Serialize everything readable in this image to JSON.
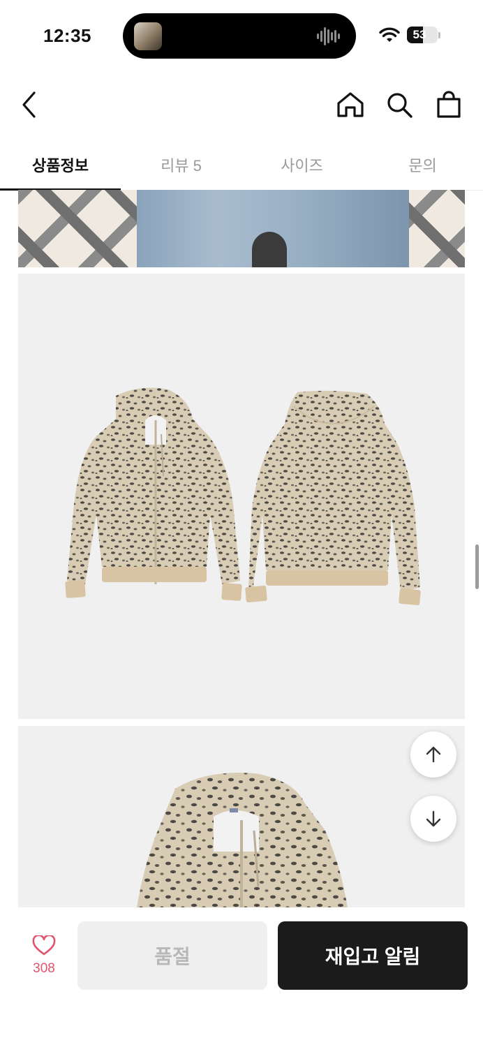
{
  "status_bar": {
    "time": "12:35",
    "battery": "53",
    "battery_level_percent": 53
  },
  "nav": {
    "back_icon": "chevron-left-icon",
    "home_icon": "home-icon",
    "search_icon": "search-icon",
    "cart_icon": "shopping-bag-icon"
  },
  "tabs": [
    {
      "label": "상품정보",
      "active": true
    },
    {
      "label": "리뷰 5",
      "active": false
    },
    {
      "label": "사이즈",
      "active": false
    },
    {
      "label": "문의",
      "active": false
    }
  ],
  "floating": {
    "up_icon": "arrow-up-icon",
    "down_icon": "arrow-down-icon"
  },
  "bottom": {
    "like_icon": "heart-icon",
    "like_count": "308",
    "soldout_label": "품절",
    "restock_label": "재입고 알림"
  },
  "colors": {
    "accent_heart": "#e0556b",
    "primary_button": "#1b1b1b",
    "disabled_button": "#efefef",
    "leopard_base": "#d9ccb4",
    "leopard_spot": "#4b4a44"
  }
}
